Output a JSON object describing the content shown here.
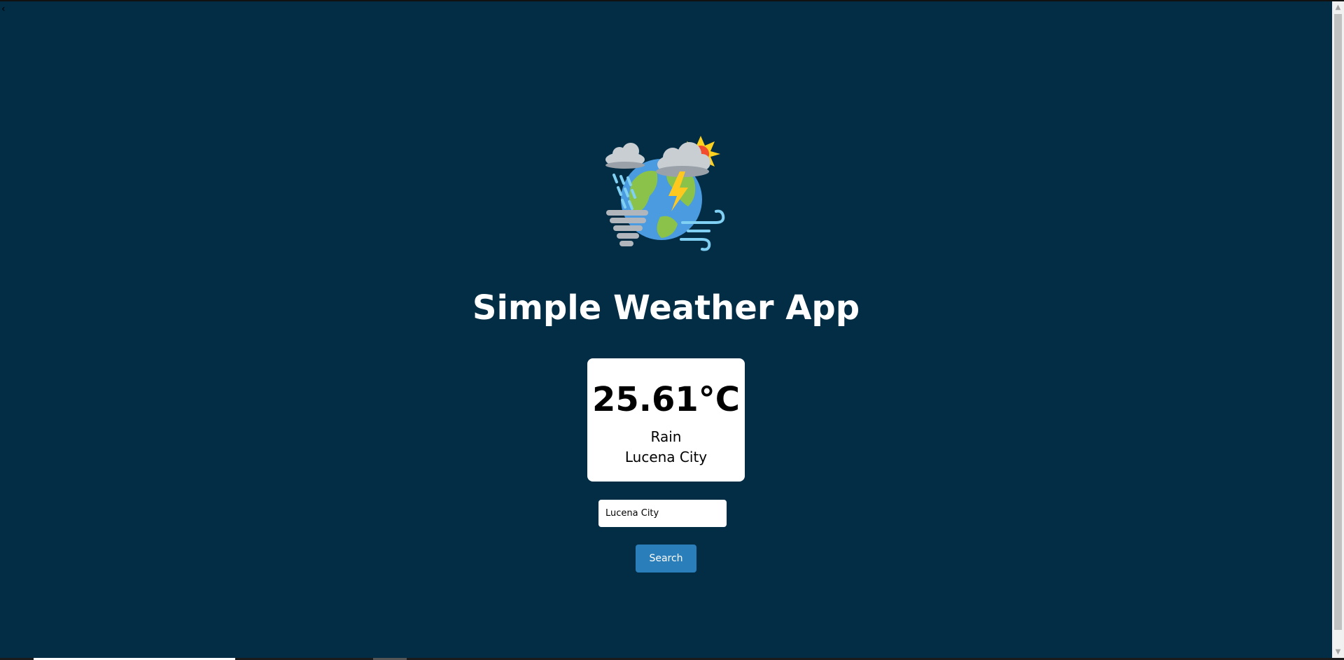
{
  "app": {
    "title": "Simple Weather App",
    "logo_icon": "weather-globe-icon"
  },
  "weather": {
    "temperature": "25.61°C",
    "condition": "Rain",
    "city": "Lucena City"
  },
  "search": {
    "value": "Lucena City",
    "button_label": "Search"
  },
  "colors": {
    "background": "#032d45",
    "button": "#2a7fba",
    "card": "#ffffff"
  }
}
